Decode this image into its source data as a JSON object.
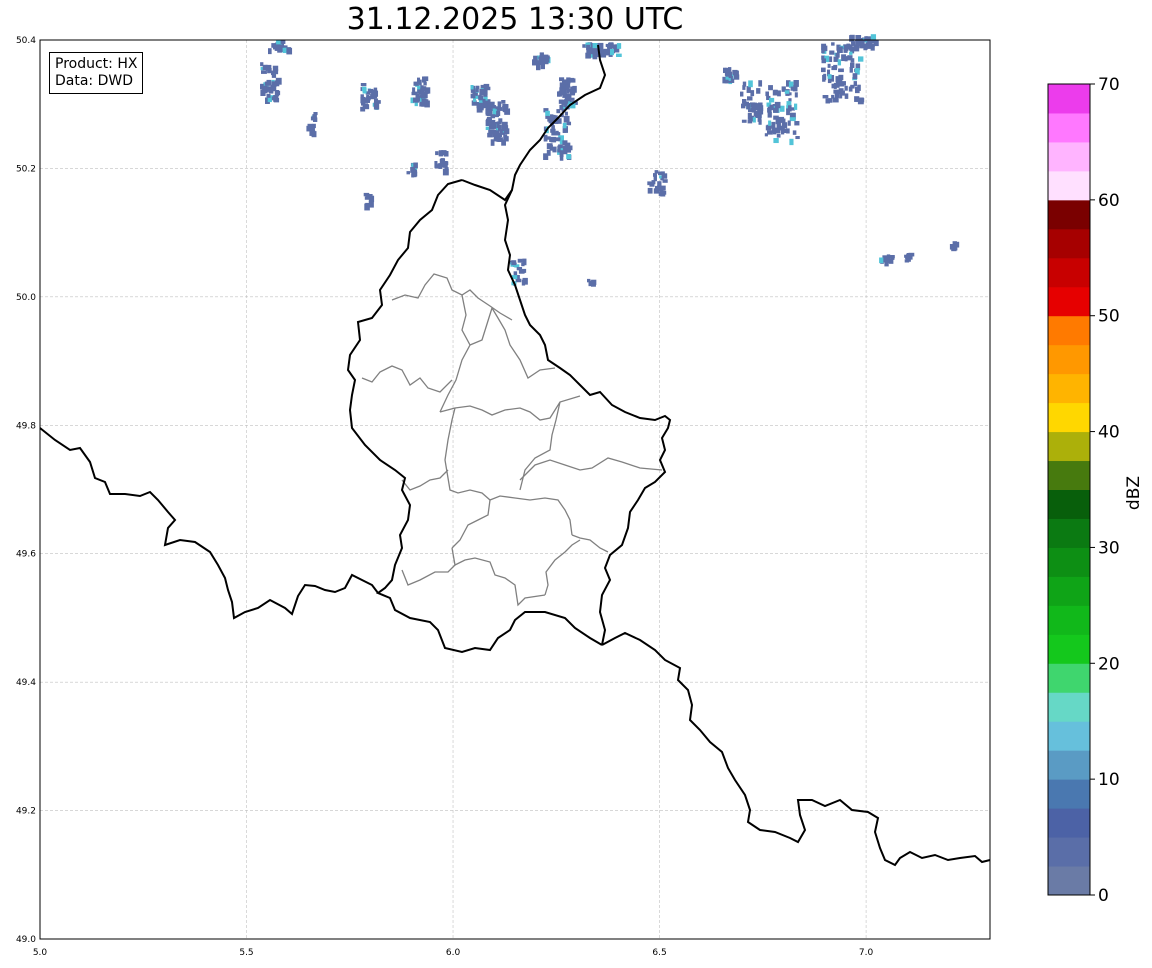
{
  "map": {
    "title": "31.12.2025 13:30 UTC",
    "info": {
      "product": "Product: HX",
      "source": "Data: DWD"
    },
    "lon_range": [
      5.0,
      7.3
    ],
    "lat_range": [
      49.0,
      50.4
    ],
    "lon_ticks": [
      "5.0",
      "5.5",
      "6.0",
      "6.5",
      "7.0"
    ],
    "lat_ticks": [
      "49.0",
      "49.2",
      "49.4",
      "49.6",
      "49.8",
      "50.0",
      "50.2",
      "50.4"
    ],
    "grid": true
  },
  "colorbar": {
    "label": "dBZ",
    "range": [
      0,
      70
    ],
    "tick_labels": [
      "0",
      "10",
      "20",
      "30",
      "40",
      "50",
      "60",
      "70"
    ],
    "colors": [
      "#6a7ba6",
      "#5a6ea8",
      "#4c62a6",
      "#4a78b0",
      "#5a9bc4",
      "#66c0dc",
      "#66d8c6",
      "#3fd66e",
      "#14c81c",
      "#11b81a",
      "#0fa417",
      "#0d8f14",
      "#0b7a12",
      "#085f0b",
      "#477a0e",
      "#acb00a",
      "#ffd700",
      "#ffb400",
      "#ff9800",
      "#ff7a00",
      "#e60000",
      "#c80000",
      "#a60000",
      "#7a0000",
      "#ffe0ff",
      "#ffb4ff",
      "#ff78ff",
      "#ec3cec"
    ]
  },
  "colors": {
    "country_border": "#000000",
    "admin_border": "#808080",
    "grid": "#c0c0c0",
    "echo_low": "#5b6ea8",
    "echo_mid": "#52c4d8"
  }
}
